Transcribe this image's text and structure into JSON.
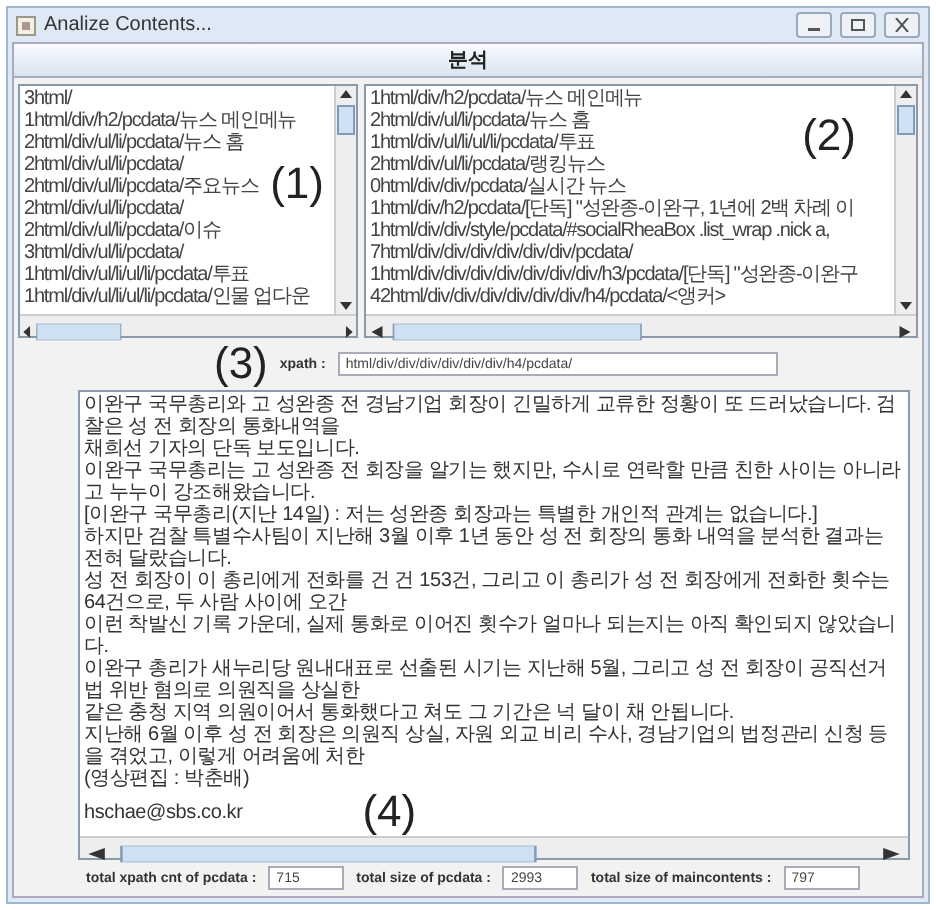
{
  "window": {
    "title": "Analize Contents..."
  },
  "header": {
    "title": "분석"
  },
  "lists": [
    {
      "annotation": "(1)",
      "items": [
        "3html/",
        "1html/div/h2/pcdata/뉴스 메인메뉴",
        "2html/div/ul/li/pcdata/뉴스 홈",
        "2html/div/ul/li/pcdata/",
        "2html/div/ul/li/pcdata/주요뉴스",
        "2html/div/ul/li/pcdata/",
        "2html/div/ul/li/pcdata/이슈",
        "3html/div/ul/li/pcdata/",
        "1html/div/ul/li/ul/li/pcdata/투표",
        "1html/div/ul/li/ul/li/pcdata/인물 업다운"
      ]
    },
    {
      "annotation": "(2)",
      "items": [
        "1html/div/h2/pcdata/뉴스 메인메뉴",
        "2html/div/ul/li/pcdata/뉴스 홈",
        "1html/div/ul/li/ul/li/pcdata/투표",
        "2html/div/ul/li/pcdata/랭킹뉴스",
        "0html/div/div/pcdata/실시간 뉴스",
        "1html/div/h2/pcdata/[단독] \"성완종-이완구, 1년에 2백 차례 이",
        "1html/div/div/style/pcdata/#socialRheaBox .list_wrap .nick a,",
        "7html/div/div/div/div/div/div/pcdata/",
        "1html/div/div/div/div/div/div/div/h3/pcdata/[단독] \"성완종-이완구",
        "42html/div/div/div/div/div/div/h4/pcdata/<앵커>"
      ]
    }
  ],
  "xpath": {
    "annotation": "(3)",
    "label": "xpath :",
    "value": "html/div/div/div/div/div/div/h4/pcdata/"
  },
  "content": {
    "annotation": "(4)",
    "lines": [
      "이완구 국무총리와 고 성완종 전 경남기업 회장이 긴밀하게 교류한 정황이 또 드러났습니다. 검찰은 성 전 회장의 통화내역을",
      "채희선 기자의 단독 보도입니다.",
      "이완구 국무총리는 고 성완종 전 회장을 알기는 했지만, 수시로 연락할 만큼 친한 사이는 아니라고 누누이 강조해왔습니다.",
      "[이완구 국무총리(지난 14일) : 저는 성완종 회장과는 특별한 개인적 관계는 없습니다.]",
      "하지만 검찰 특별수사팀이 지난해 3월 이후 1년 동안 성 전 회장의 통화 내역을 분석한 결과는 전혀 달랐습니다.",
      "성 전 회장이 이 총리에게 전화를 건 건 153건, 그리고 이 총리가 성 전 회장에게 전화한 횟수는 64건으로, 두 사람 사이에 오간",
      "이런 착발신 기록 가운데, 실제 통화로 이어진 횟수가 얼마나 되는지는 아직 확인되지 않았습니다.",
      "이완구 총리가 새누리당 원내대표로 선출된 시기는 지난해 5월, 그리고 성 전 회장이 공직선거법 위반 혐의로 의원직을 상실한",
      "같은 충청 지역 의원이어서 통화했다고 쳐도 그 기간은 넉 달이 채 안됩니다.",
      "지난해 6월 이후 성 전 회장은 의원직 상실, 자원 외교 비리 수사, 경남기업의 법정관리 신청 등을 겪었고, 이렇게 어려움에 처한",
      "(영상편집 : 박춘배)",
      "hschae@sbs.co.kr"
    ]
  },
  "totals": [
    {
      "label": "total xpath cnt of pcdata :",
      "value": "715"
    },
    {
      "label": "total size of pcdata :",
      "value": "2993"
    },
    {
      "label": "total size of maincontents :",
      "value": "797"
    }
  ]
}
